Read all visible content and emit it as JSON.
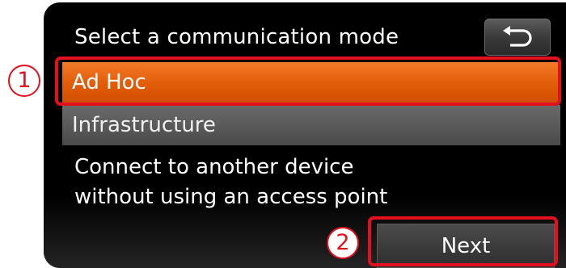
{
  "screen": {
    "title": "Select a communication mode",
    "back_icon": "return-arrow-icon",
    "options": [
      {
        "label": "Ad Hoc",
        "selected": true
      },
      {
        "label": "Infrastructure",
        "selected": false
      }
    ],
    "description_lines": [
      "Connect to another device",
      "without using an access point"
    ],
    "next_label": "Next"
  },
  "callouts": {
    "step1": "1",
    "step2": "2"
  },
  "colors": {
    "selected_option": "#e25c08",
    "callout_red": "#e3101e",
    "screen_background": "#000000"
  }
}
